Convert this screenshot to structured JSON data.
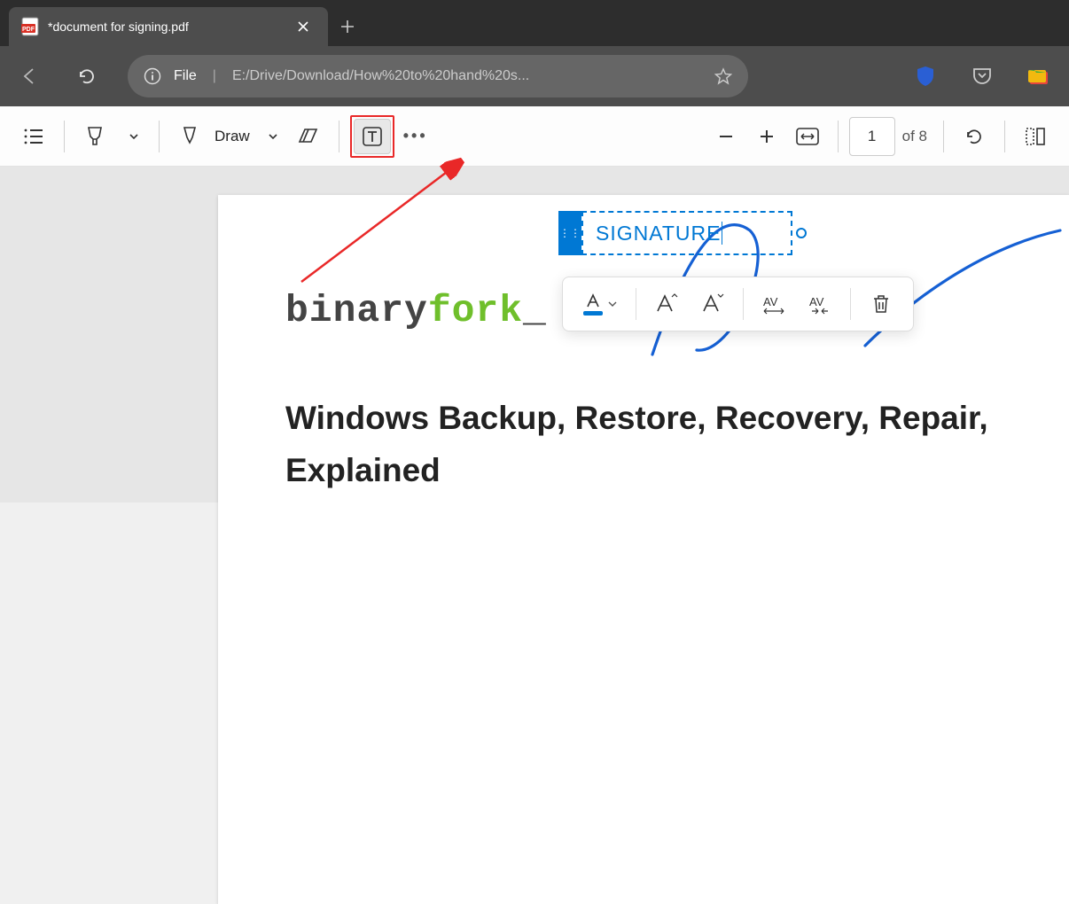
{
  "tab": {
    "title": "*document for signing.pdf"
  },
  "address": {
    "scheme": "File",
    "path": "E:/Drive/Download/How%20to%20hand%20s..."
  },
  "toolbar": {
    "draw_label": "Draw",
    "page_current": "1",
    "page_total": "of 8"
  },
  "annotation": {
    "text": "SIGNATURE"
  },
  "document": {
    "logo_part1": "binary",
    "logo_part2": "fork",
    "logo_part3": "_",
    "heading_line1": "Windows Backup, Restore, Recovery, Repair,",
    "heading_line2": "Explained"
  }
}
